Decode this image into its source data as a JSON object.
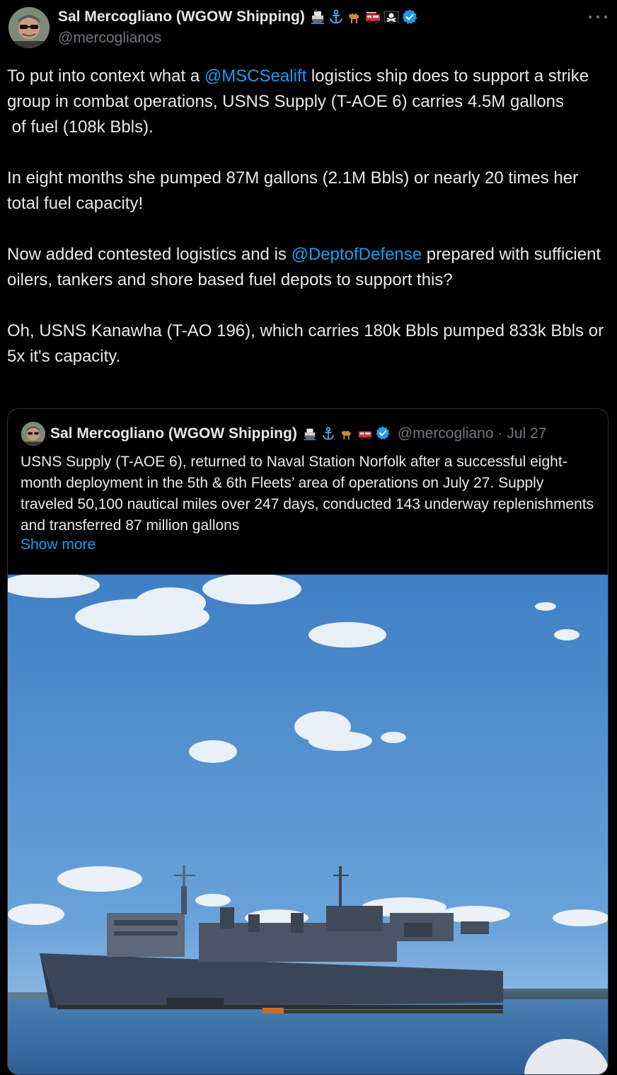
{
  "colors": {
    "background": "#000000",
    "text": "#e7e9ea",
    "secondary_text": "#71767b",
    "link": "#1d9bf0",
    "verified": "#1d9bf0"
  },
  "tweet": {
    "author": {
      "name": "Sal Mercogliano (WGOW Shipping)",
      "handle": "@mercoglianos",
      "emojis": [
        "ship-emoji",
        "anchor-emoji",
        "camel-emoji",
        "fire-engine-emoji",
        "pirate-flag-emoji"
      ],
      "verified": true
    },
    "paragraphs": {
      "p1_pre": "To put into context what a ",
      "p1_mention": "@MSCSealift",
      "p1_post": " logistics ship does to support a strike group in combat operations, USNS Supply (T-AOE 6) carries 4.5M gallons",
      "p1_line2": " of fuel (108k Bbls).",
      "p2": "In eight months she pumped 87M gallons (2.1M Bbls) or nearly 20 times her total fuel capacity!",
      "p3_pre": "Now added contested logistics and is ",
      "p3_mention": "@DeptofDefense",
      "p3_post": " prepared with sufficient oilers, tankers and shore based fuel depots to support this?",
      "p4": "Oh, USNS Kanawha (T-AO 196), which carries 180k Bbls pumped 833k Bbls or 5x it's capacity."
    }
  },
  "quoted_tweet": {
    "author": {
      "name": "Sal Mercogliano (WGOW Shipping)",
      "handle": "@mercogliano",
      "date": "· Jul 27",
      "verified": true
    },
    "text": "USNS Supply (T-AOE 6), returned to Naval Station Norfolk after a successful eight-month deployment in the 5th & 6th Fleets’ area of operations on July 27. Supply traveled 50,100 nautical miles over 247 days, conducted 143 underway replenishments and transferred 87 million gallons",
    "show_more": "Show more",
    "image": "ship-photo"
  }
}
